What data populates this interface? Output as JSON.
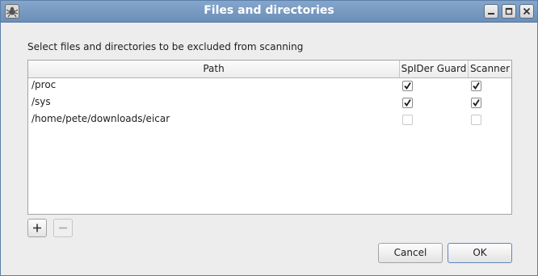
{
  "window": {
    "title": "Files and directories",
    "icons": {
      "app": "spider-app-icon",
      "minimize": "minimize-icon",
      "maximize": "maximize-icon",
      "close": "close-icon"
    }
  },
  "dialog": {
    "prompt": "Select files and directories to be excluded from scanning",
    "columns": {
      "path": "Path",
      "guard": "SpIDer Guard",
      "scanner": "Scanner"
    },
    "rows": [
      {
        "path": "/proc",
        "spider_guard": true,
        "scanner": true
      },
      {
        "path": "/sys",
        "spider_guard": true,
        "scanner": true
      },
      {
        "path": "/home/pete/downloads/eicar",
        "spider_guard": false,
        "scanner": false
      }
    ]
  },
  "actions": {
    "add_icon": "plus-icon",
    "remove_icon": "minus-icon",
    "cancel_label": "Cancel",
    "ok_label": "OK"
  },
  "colors": {
    "titlebar": "#7a9cc3",
    "ok_border": "#5f87b6"
  }
}
